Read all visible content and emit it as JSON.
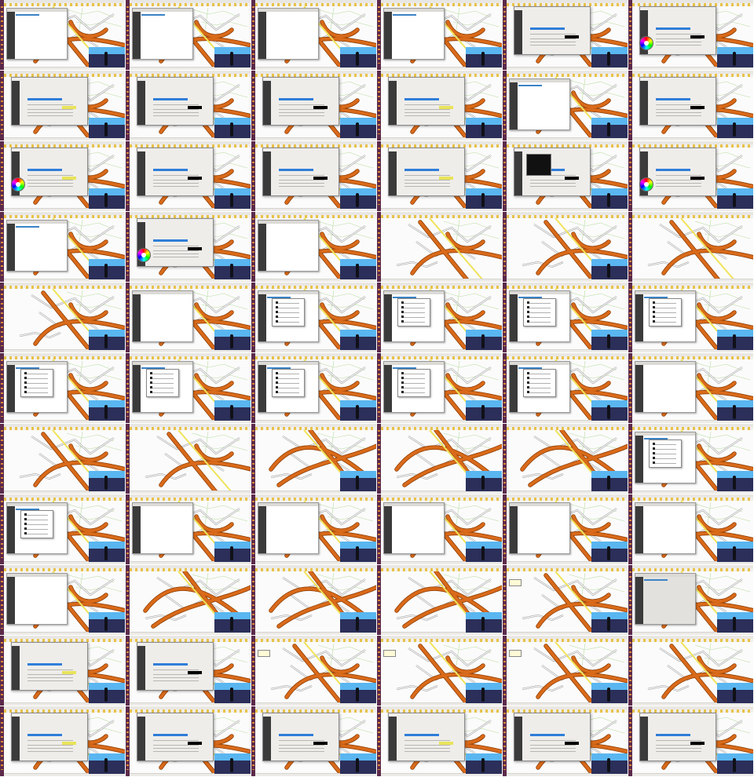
{
  "sheet": {
    "rows": 11,
    "cols": 6,
    "frames": [
      "qgis-layer-panel",
      "qgis-layer-panel",
      "qgis-layer-panel-blank",
      "qgis-layer-panel",
      "qgis-properties-dialog",
      "qgis-properties-colorwheel",
      "qgis-properties-dialog",
      "qgis-properties-dialog",
      "qgis-properties-dialog",
      "qgis-properties-dialog",
      "qgis-layer-panel",
      "qgis-properties-dialog",
      "qgis-properties-colorwheel",
      "qgis-properties-dialog",
      "qgis-properties-dialog",
      "qgis-properties-dialog",
      "qgis-black-dialog",
      "qgis-properties-colorwheel",
      "qgis-layer-panel",
      "qgis-properties-colorwheel",
      "qgis-layer-panel-blank",
      "map-grid",
      "map-grid",
      "map-grid",
      "map-grid",
      "qgis-layer-panel-blank",
      "qgis-small-dialog",
      "qgis-small-dialog",
      "qgis-small-dialog",
      "qgis-small-dialog",
      "qgis-small-dialog",
      "qgis-small-dialog",
      "qgis-small-dialog",
      "qgis-small-dialog",
      "qgis-small-dialog",
      "qgis-layer-panel-blank",
      "map-grid",
      "map-grid",
      "map-intersection",
      "map-intersection",
      "map-intersection",
      "qgis-small-dialog",
      "qgis-small-dialog",
      "qgis-layer-panel-blank",
      "qgis-layer-panel-blank",
      "qgis-layer-panel-blank",
      "qgis-layer-panel-blank",
      "qgis-layer-panel-blank",
      "qgis-layer-panel-blank",
      "map-intersection",
      "map-intersection",
      "map-intersection",
      "map-tooltip",
      "qgis-gray-dialog",
      "qgis-properties-dialog",
      "qgis-properties-dialog",
      "map-tooltip",
      "map-tooltip",
      "map-tooltip",
      "map-video",
      "qgis-properties-dialog",
      "qgis-properties-dialog",
      "qgis-properties-dialog",
      "qgis-properties-dialog",
      "qgis-properties-dialog",
      "qgis-properties-dialog"
    ]
  },
  "colors": {
    "launcher": "#5c2a4b",
    "highway": "#d96a1a",
    "highway_edge": "#8a3a00",
    "secondary": "#f0e35a",
    "street": "#9a9a9a",
    "green_lines": "#b9dca0",
    "selection": "#2f7ed8",
    "video_sky": "#5ab6f0"
  },
  "icons": {
    "launcher": "app-launcher-icon",
    "wheel": "color-wheel-icon"
  }
}
